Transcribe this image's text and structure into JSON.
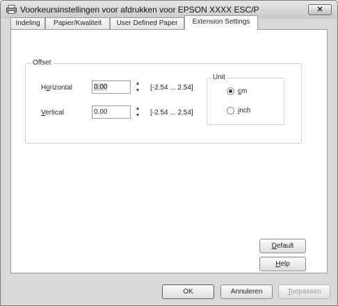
{
  "window": {
    "title": "Voorkeursinstellingen voor afdrukken voor EPSON XXXX ESC/P",
    "close_icon": "close-x-icon"
  },
  "tabs": [
    {
      "label": "Indeling"
    },
    {
      "label": "Papier/Kwaliteit"
    },
    {
      "label": "User Defined Paper"
    },
    {
      "label": "Extension Settings",
      "active": true
    }
  ],
  "offset": {
    "legend": "Offset",
    "horizontal": {
      "label_pre": "H",
      "label_u": "o",
      "label_post": "rizontal",
      "value": "0.00",
      "range": "[-2.54 ... 2.54]"
    },
    "vertical": {
      "label_pre": "",
      "label_u": "V",
      "label_post": "ertical",
      "value": "0.00",
      "range": "[-2.54 ... 2.54]"
    }
  },
  "unit": {
    "legend": "Unit",
    "options": [
      {
        "label_u": "c",
        "label_post": "m",
        "selected": true
      },
      {
        "label_u": "i",
        "label_post": "nch",
        "selected": false
      }
    ]
  },
  "buttons": {
    "default": {
      "label_u": "D",
      "label_post": "efault"
    },
    "help": {
      "label_u": "H",
      "label_post": "elp"
    },
    "ok": "OK",
    "cancel": "Annuleren",
    "apply": {
      "label_u": "T",
      "label_post": "oepassen"
    }
  }
}
